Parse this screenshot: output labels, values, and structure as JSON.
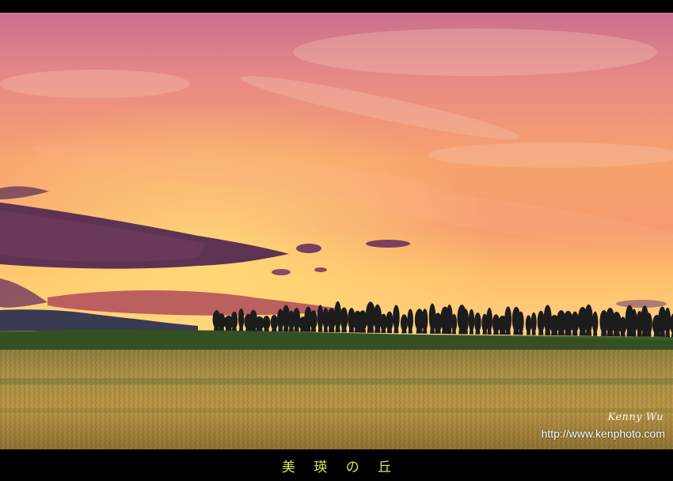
{
  "photo": {
    "signature": "Kenny Wu",
    "url": "http://www.kenphoto.com"
  },
  "caption": "美 瑛 の 丘",
  "colors": {
    "sky_top": "#d9748f",
    "sky_mid": "#f6a070",
    "sky_horizon": "#ffd070",
    "cloud_dark": "#6a3a5a",
    "tree_line": "#1a1a1a",
    "field_green": "#3c5a28",
    "field_gold": "#b99445",
    "caption_color": "#d6e85a"
  }
}
